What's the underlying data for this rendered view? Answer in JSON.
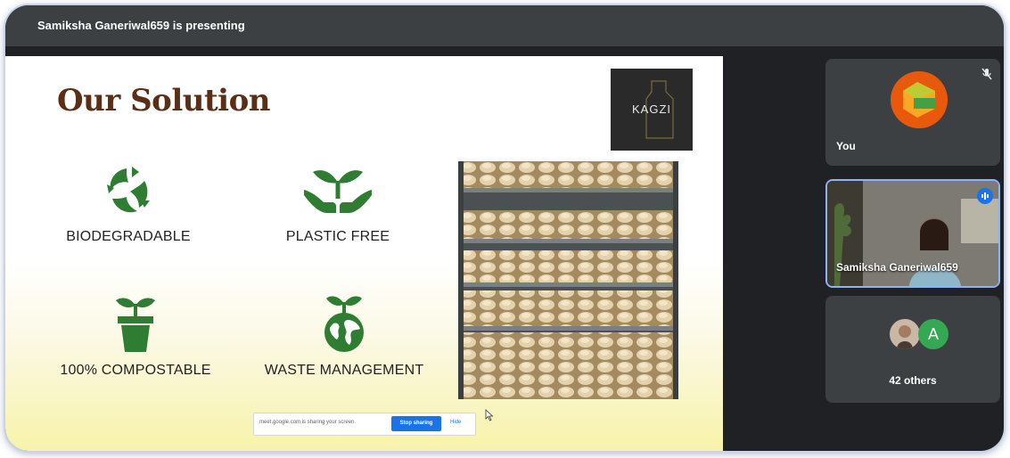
{
  "presenter": {
    "label": "Samiksha Ganeriwal659 is presenting"
  },
  "slide": {
    "title": "Our Solution",
    "logo_text": "KAGZI",
    "features": [
      {
        "label": "BIODEGRADABLE",
        "icon": "recycle-leaves-icon"
      },
      {
        "label": "PLASTIC FREE",
        "icon": "plant-in-hands-icon"
      },
      {
        "label": "100% COMPOSTABLE",
        "icon": "potted-plant-icon"
      },
      {
        "label": "WASTE MANAGEMENT",
        "icon": "earth-sprout-icon"
      }
    ],
    "photo": "egg-trays-drying-racks-photo"
  },
  "share_bar": {
    "message": "meet.google.com is sharing your screen.",
    "stop_label": "Stop sharing",
    "hide_label": "Hide"
  },
  "participants": {
    "you": {
      "name": "You",
      "mic": "muted"
    },
    "speaker": {
      "name": "Samiksha Ganeriwal659",
      "status": "speaking"
    },
    "others": {
      "label": "42 others",
      "avatar_letter": "A"
    }
  },
  "colors": {
    "title": "#5b2e16",
    "icon_green": "#2e7d32",
    "accent_blue": "#1a73e8",
    "tile_bg": "#3c4043",
    "meet_bg": "#202124"
  }
}
